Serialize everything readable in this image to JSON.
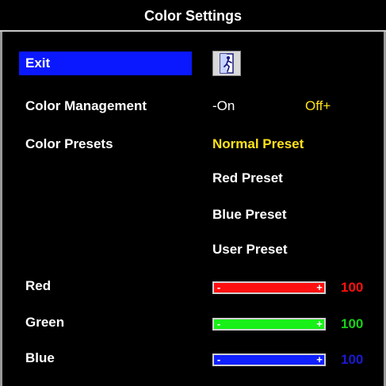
{
  "title": "Color Settings",
  "menu": {
    "exit_label": "Exit",
    "color_management_label": "Color Management",
    "color_presets_label": "Color Presets",
    "red_label": "Red",
    "green_label": "Green",
    "blue_label": "Blue"
  },
  "color_management": {
    "on_label": "-On",
    "off_label": "Off+",
    "selected": "Off+"
  },
  "presets": {
    "options": [
      "Normal Preset",
      "Red Preset",
      "Blue Preset",
      "User Preset"
    ],
    "selected": "Normal Preset"
  },
  "sliders": {
    "red": {
      "value": "100",
      "level_percent": 100,
      "color": "#ff1010"
    },
    "green": {
      "value": "100",
      "level_percent": 100,
      "color": "#18f018"
    },
    "blue": {
      "value": "100",
      "level_percent": 100,
      "color": "#1020ff"
    },
    "minus_symbol": "-",
    "plus_symbol": "+"
  },
  "icons": {
    "exit": "exit-door-icon"
  },
  "colors": {
    "highlight_bar": "#0a18ff",
    "selected_text": "#ffe11a",
    "value_red": "#ff1010",
    "value_green": "#18d018",
    "value_blue": "#1a1ad0"
  }
}
